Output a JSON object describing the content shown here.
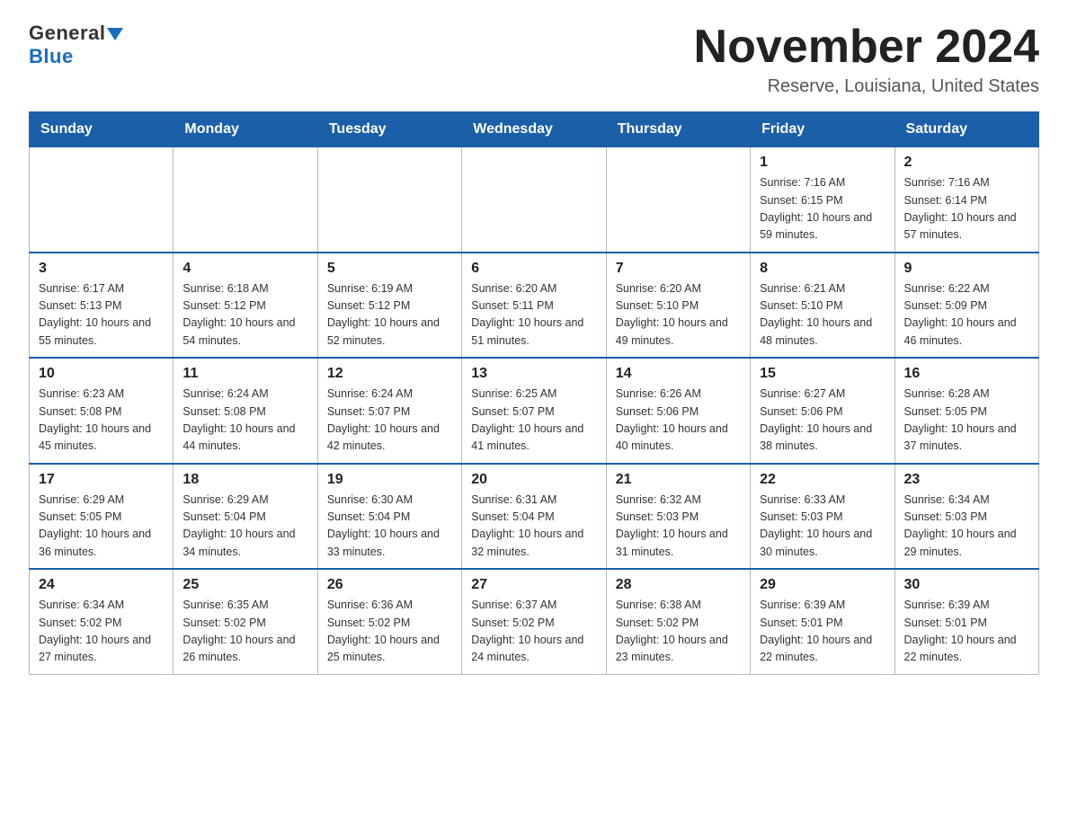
{
  "logo": {
    "general": "General",
    "blue": "Blue"
  },
  "header": {
    "month_year": "November 2024",
    "location": "Reserve, Louisiana, United States"
  },
  "days_of_week": [
    "Sunday",
    "Monday",
    "Tuesday",
    "Wednesday",
    "Thursday",
    "Friday",
    "Saturday"
  ],
  "weeks": [
    [
      {
        "day": "",
        "sunrise": "",
        "sunset": "",
        "daylight": ""
      },
      {
        "day": "",
        "sunrise": "",
        "sunset": "",
        "daylight": ""
      },
      {
        "day": "",
        "sunrise": "",
        "sunset": "",
        "daylight": ""
      },
      {
        "day": "",
        "sunrise": "",
        "sunset": "",
        "daylight": ""
      },
      {
        "day": "",
        "sunrise": "",
        "sunset": "",
        "daylight": ""
      },
      {
        "day": "1",
        "sunrise": "Sunrise: 7:16 AM",
        "sunset": "Sunset: 6:15 PM",
        "daylight": "Daylight: 10 hours and 59 minutes."
      },
      {
        "day": "2",
        "sunrise": "Sunrise: 7:16 AM",
        "sunset": "Sunset: 6:14 PM",
        "daylight": "Daylight: 10 hours and 57 minutes."
      }
    ],
    [
      {
        "day": "3",
        "sunrise": "Sunrise: 6:17 AM",
        "sunset": "Sunset: 5:13 PM",
        "daylight": "Daylight: 10 hours and 55 minutes."
      },
      {
        "day": "4",
        "sunrise": "Sunrise: 6:18 AM",
        "sunset": "Sunset: 5:12 PM",
        "daylight": "Daylight: 10 hours and 54 minutes."
      },
      {
        "day": "5",
        "sunrise": "Sunrise: 6:19 AM",
        "sunset": "Sunset: 5:12 PM",
        "daylight": "Daylight: 10 hours and 52 minutes."
      },
      {
        "day": "6",
        "sunrise": "Sunrise: 6:20 AM",
        "sunset": "Sunset: 5:11 PM",
        "daylight": "Daylight: 10 hours and 51 minutes."
      },
      {
        "day": "7",
        "sunrise": "Sunrise: 6:20 AM",
        "sunset": "Sunset: 5:10 PM",
        "daylight": "Daylight: 10 hours and 49 minutes."
      },
      {
        "day": "8",
        "sunrise": "Sunrise: 6:21 AM",
        "sunset": "Sunset: 5:10 PM",
        "daylight": "Daylight: 10 hours and 48 minutes."
      },
      {
        "day": "9",
        "sunrise": "Sunrise: 6:22 AM",
        "sunset": "Sunset: 5:09 PM",
        "daylight": "Daylight: 10 hours and 46 minutes."
      }
    ],
    [
      {
        "day": "10",
        "sunrise": "Sunrise: 6:23 AM",
        "sunset": "Sunset: 5:08 PM",
        "daylight": "Daylight: 10 hours and 45 minutes."
      },
      {
        "day": "11",
        "sunrise": "Sunrise: 6:24 AM",
        "sunset": "Sunset: 5:08 PM",
        "daylight": "Daylight: 10 hours and 44 minutes."
      },
      {
        "day": "12",
        "sunrise": "Sunrise: 6:24 AM",
        "sunset": "Sunset: 5:07 PM",
        "daylight": "Daylight: 10 hours and 42 minutes."
      },
      {
        "day": "13",
        "sunrise": "Sunrise: 6:25 AM",
        "sunset": "Sunset: 5:07 PM",
        "daylight": "Daylight: 10 hours and 41 minutes."
      },
      {
        "day": "14",
        "sunrise": "Sunrise: 6:26 AM",
        "sunset": "Sunset: 5:06 PM",
        "daylight": "Daylight: 10 hours and 40 minutes."
      },
      {
        "day": "15",
        "sunrise": "Sunrise: 6:27 AM",
        "sunset": "Sunset: 5:06 PM",
        "daylight": "Daylight: 10 hours and 38 minutes."
      },
      {
        "day": "16",
        "sunrise": "Sunrise: 6:28 AM",
        "sunset": "Sunset: 5:05 PM",
        "daylight": "Daylight: 10 hours and 37 minutes."
      }
    ],
    [
      {
        "day": "17",
        "sunrise": "Sunrise: 6:29 AM",
        "sunset": "Sunset: 5:05 PM",
        "daylight": "Daylight: 10 hours and 36 minutes."
      },
      {
        "day": "18",
        "sunrise": "Sunrise: 6:29 AM",
        "sunset": "Sunset: 5:04 PM",
        "daylight": "Daylight: 10 hours and 34 minutes."
      },
      {
        "day": "19",
        "sunrise": "Sunrise: 6:30 AM",
        "sunset": "Sunset: 5:04 PM",
        "daylight": "Daylight: 10 hours and 33 minutes."
      },
      {
        "day": "20",
        "sunrise": "Sunrise: 6:31 AM",
        "sunset": "Sunset: 5:04 PM",
        "daylight": "Daylight: 10 hours and 32 minutes."
      },
      {
        "day": "21",
        "sunrise": "Sunrise: 6:32 AM",
        "sunset": "Sunset: 5:03 PM",
        "daylight": "Daylight: 10 hours and 31 minutes."
      },
      {
        "day": "22",
        "sunrise": "Sunrise: 6:33 AM",
        "sunset": "Sunset: 5:03 PM",
        "daylight": "Daylight: 10 hours and 30 minutes."
      },
      {
        "day": "23",
        "sunrise": "Sunrise: 6:34 AM",
        "sunset": "Sunset: 5:03 PM",
        "daylight": "Daylight: 10 hours and 29 minutes."
      }
    ],
    [
      {
        "day": "24",
        "sunrise": "Sunrise: 6:34 AM",
        "sunset": "Sunset: 5:02 PM",
        "daylight": "Daylight: 10 hours and 27 minutes."
      },
      {
        "day": "25",
        "sunrise": "Sunrise: 6:35 AM",
        "sunset": "Sunset: 5:02 PM",
        "daylight": "Daylight: 10 hours and 26 minutes."
      },
      {
        "day": "26",
        "sunrise": "Sunrise: 6:36 AM",
        "sunset": "Sunset: 5:02 PM",
        "daylight": "Daylight: 10 hours and 25 minutes."
      },
      {
        "day": "27",
        "sunrise": "Sunrise: 6:37 AM",
        "sunset": "Sunset: 5:02 PM",
        "daylight": "Daylight: 10 hours and 24 minutes."
      },
      {
        "day": "28",
        "sunrise": "Sunrise: 6:38 AM",
        "sunset": "Sunset: 5:02 PM",
        "daylight": "Daylight: 10 hours and 23 minutes."
      },
      {
        "day": "29",
        "sunrise": "Sunrise: 6:39 AM",
        "sunset": "Sunset: 5:01 PM",
        "daylight": "Daylight: 10 hours and 22 minutes."
      },
      {
        "day": "30",
        "sunrise": "Sunrise: 6:39 AM",
        "sunset": "Sunset: 5:01 PM",
        "daylight": "Daylight: 10 hours and 22 minutes."
      }
    ]
  ]
}
